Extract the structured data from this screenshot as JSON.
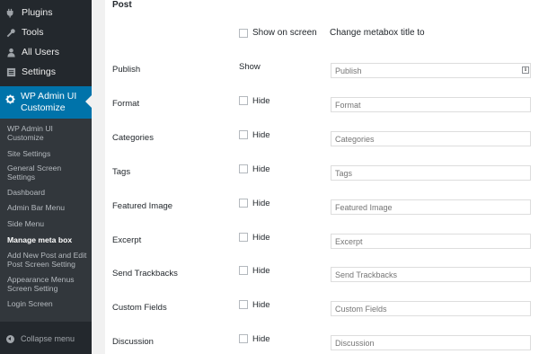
{
  "sidebar": {
    "items": [
      {
        "label": "Plugins",
        "icon": "plugin-icon"
      },
      {
        "label": "Tools",
        "icon": "wrench-icon"
      },
      {
        "label": "All Users",
        "icon": "user-icon"
      },
      {
        "label": "Settings",
        "icon": "settings-icon"
      }
    ],
    "active": {
      "label": "WP Admin UI Customize",
      "icon": "gear-icon"
    },
    "submenu": [
      "WP Admin UI Customize",
      "Site Settings",
      "General Screen Settings",
      "Dashboard",
      "Admin Bar Menu",
      "Side Menu",
      "Manage meta box",
      "Add New Post and Edit Post Screen Setting",
      "Appearance Menus Screen Setting",
      "Login Screen"
    ],
    "current_submenu": "Manage meta box",
    "collapse_label": "Collapse menu"
  },
  "panel": {
    "title": "Post",
    "header": {
      "show_on_screen": "Show on screen",
      "change_title": "Change metabox title to"
    },
    "rows": [
      {
        "label": "Publish",
        "toggle": "Show",
        "placeholder": "Publish"
      },
      {
        "label": "Format",
        "toggle": "Hide",
        "placeholder": "Format"
      },
      {
        "label": "Categories",
        "toggle": "Hide",
        "placeholder": "Categories"
      },
      {
        "label": "Tags",
        "toggle": "Hide",
        "placeholder": "Tags"
      },
      {
        "label": "Featured Image",
        "toggle": "Hide",
        "placeholder": "Featured Image"
      },
      {
        "label": "Excerpt",
        "toggle": "Hide",
        "placeholder": "Excerpt"
      },
      {
        "label": "Send Trackbacks",
        "toggle": "Hide",
        "placeholder": "Send Trackbacks"
      },
      {
        "label": "Custom Fields",
        "toggle": "Hide",
        "placeholder": "Custom Fields"
      },
      {
        "label": "Discussion",
        "toggle": "Hide",
        "placeholder": "Discussion"
      }
    ],
    "publish_field_icon": "ℹ"
  },
  "colors": {
    "sidebar_bg": "#23282d",
    "submenu_bg": "#32373c",
    "accent": "#0073aa",
    "content_bg": "#ffffff"
  }
}
